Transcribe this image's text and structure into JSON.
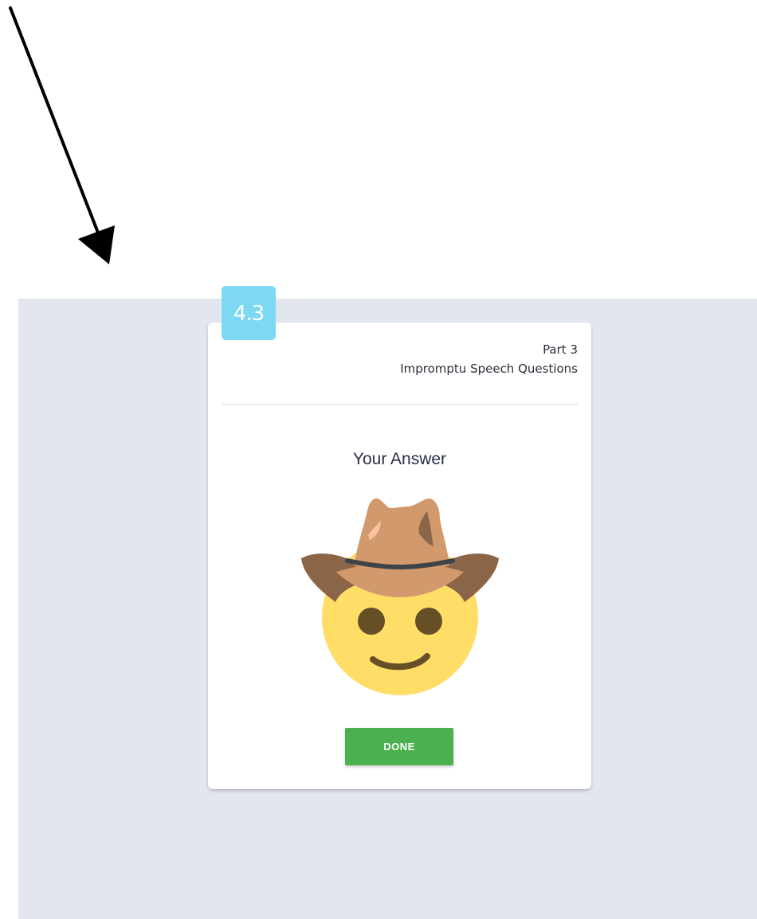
{
  "badge": {
    "number": "4.3",
    "color": "#7dd8f4"
  },
  "card": {
    "part": "Part 3",
    "subtitle": "Impromptu Speech Questions",
    "heading": "Your Answer",
    "image": {
      "icon": "cowboy-hat-face-icon"
    },
    "done_label": "DONE"
  },
  "colors": {
    "backdrop": "#e2e7ef",
    "button": "#4caf50",
    "arrow": "#000000"
  },
  "arrow": {
    "icon": "arrow-down-right-icon"
  }
}
